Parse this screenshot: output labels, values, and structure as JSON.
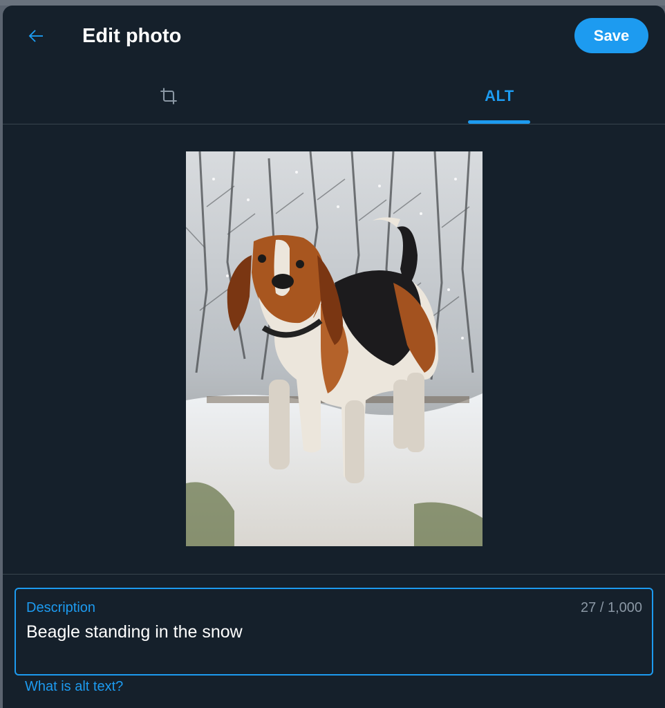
{
  "header": {
    "title": "Edit photo",
    "save_label": "Save"
  },
  "tabs": [
    {
      "name": "crop",
      "icon": "crop-icon",
      "label": ""
    },
    {
      "name": "alt",
      "label": "ALT",
      "active": true
    }
  ],
  "photo": {
    "subject": "beagle-photo"
  },
  "description": {
    "label": "Description",
    "counter": "27 / 1,000",
    "value": "Beagle standing in the snow"
  },
  "help_link": "What is alt text?",
  "colors": {
    "accent": "#1d9bf0",
    "background": "#15202b",
    "border": "#38444d",
    "muted": "#8b98a5"
  }
}
